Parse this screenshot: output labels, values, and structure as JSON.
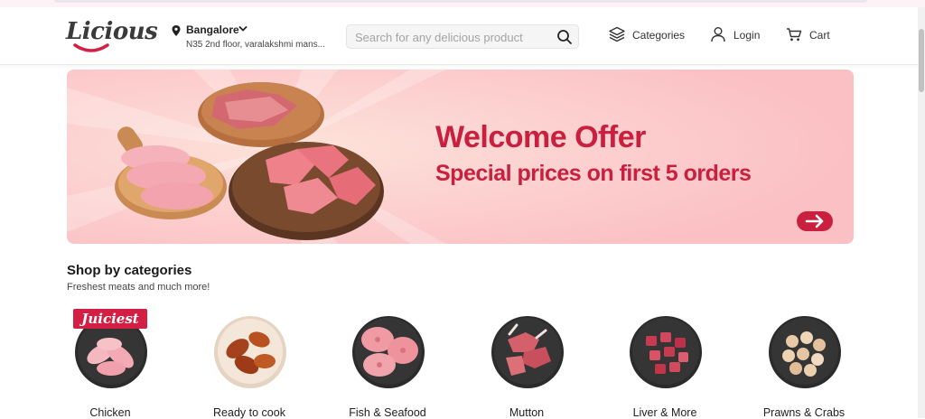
{
  "header": {
    "logo_text": "Licious",
    "location": {
      "city": "Bangalore",
      "address": "N35 2nd floor, varalakshmi mans..."
    },
    "search": {
      "placeholder": "Search for any delicious product",
      "value": ""
    },
    "nav": {
      "categories": "Categories",
      "login": "Login",
      "cart": "Cart"
    }
  },
  "banner": {
    "title": "Welcome Offer",
    "subtitle": "Special prices on first 5 orders"
  },
  "section": {
    "title": "Shop by categories",
    "subtitle": "Freshest meats and much more!",
    "badge": "Juiciest",
    "categories": [
      {
        "label": "Chicken",
        "icon": "chicken-plate"
      },
      {
        "label": "Ready to cook",
        "icon": "ready-to-cook-plate"
      },
      {
        "label": "Fish & Seafood",
        "icon": "fish-plate"
      },
      {
        "label": "Mutton",
        "icon": "mutton-plate"
      },
      {
        "label": "Liver & More",
        "icon": "liver-plate"
      },
      {
        "label": "Prawns & Crabs",
        "icon": "prawns-plate"
      }
    ]
  },
  "colors": {
    "brand": "#c8203e",
    "banner_bg": "#fbc6c9",
    "badge": "#d31f44"
  }
}
